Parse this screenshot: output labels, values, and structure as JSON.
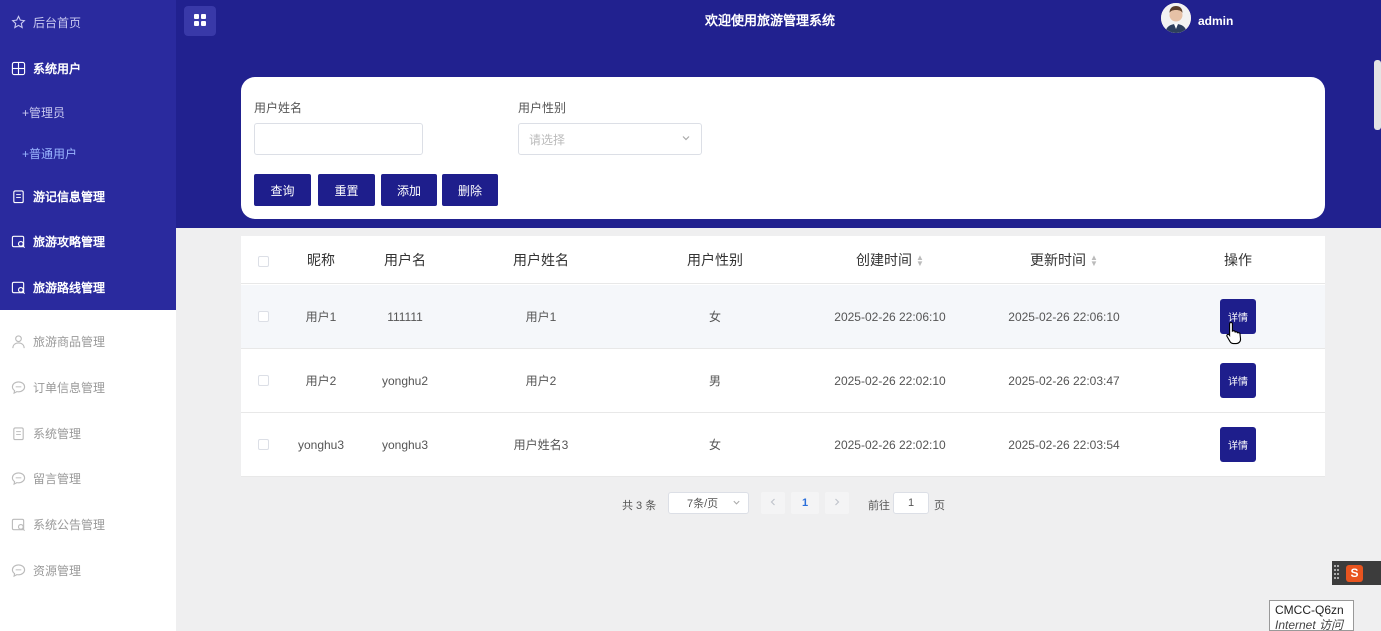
{
  "header": {
    "title": "欢迎使用旅游管理系统",
    "username": "admin"
  },
  "sidebar": {
    "items": [
      {
        "label": "后台首页",
        "icon": "star-icon"
      },
      {
        "label": "系统用户",
        "icon": "grid-icon"
      },
      {
        "label": "游记信息管理",
        "icon": "document-icon"
      },
      {
        "label": "旅游攻略管理",
        "icon": "calendar-search-icon"
      },
      {
        "label": "旅游路线管理",
        "icon": "calendar-search-icon"
      },
      {
        "label": "旅游商品管理",
        "icon": "user-icon"
      },
      {
        "label": "订单信息管理",
        "icon": "chat-icon"
      },
      {
        "label": "系统管理",
        "icon": "document-icon"
      },
      {
        "label": "留言管理",
        "icon": "chat-icon"
      },
      {
        "label": "系统公告管理",
        "icon": "calendar-search-icon"
      },
      {
        "label": "资源管理",
        "icon": "chat-icon"
      }
    ],
    "sub_items": [
      "+管理员",
      "+普通用户"
    ]
  },
  "search": {
    "name_label": "用户姓名",
    "name_value": "",
    "gender_label": "用户性别",
    "gender_placeholder": "请选择",
    "buttons": [
      "查询",
      "重置",
      "添加",
      "删除"
    ]
  },
  "table": {
    "columns": [
      "昵称",
      "用户名",
      "用户姓名",
      "用户性别",
      "创建时间",
      "更新时间",
      "操作"
    ],
    "rows": [
      {
        "nickname": "用户1",
        "username": "111111",
        "realname": "用户1",
        "gender": "女",
        "created": "2025-02-26 22:06:10",
        "updated": "2025-02-26 22:06:10",
        "action": "详情"
      },
      {
        "nickname": "用户2",
        "username": "yonghu2",
        "realname": "用户2",
        "gender": "男",
        "created": "2025-02-26 22:02:10",
        "updated": "2025-02-26 22:03:47",
        "action": "详情"
      },
      {
        "nickname": "yonghu3",
        "username": "yonghu3",
        "realname": "用户姓名3",
        "gender": "女",
        "created": "2025-02-26 22:02:10",
        "updated": "2025-02-26 22:03:54",
        "action": "详情"
      }
    ]
  },
  "pagination": {
    "total": "共 3 条",
    "page_size": "7条/页",
    "current_page": "1",
    "goto_label": "前往",
    "goto_value": "1",
    "page_suffix": "页"
  },
  "system_overlay": {
    "wifi_name": "CMCC-Q6zn",
    "wifi_status": "Internet 访问",
    "ime_label": "S"
  },
  "colors": {
    "header_bg": "#21218f",
    "sidebar_top_bg": "#2a2a9e",
    "button_bg": "#1e1e8c",
    "active_link": "#9ab5ff"
  }
}
